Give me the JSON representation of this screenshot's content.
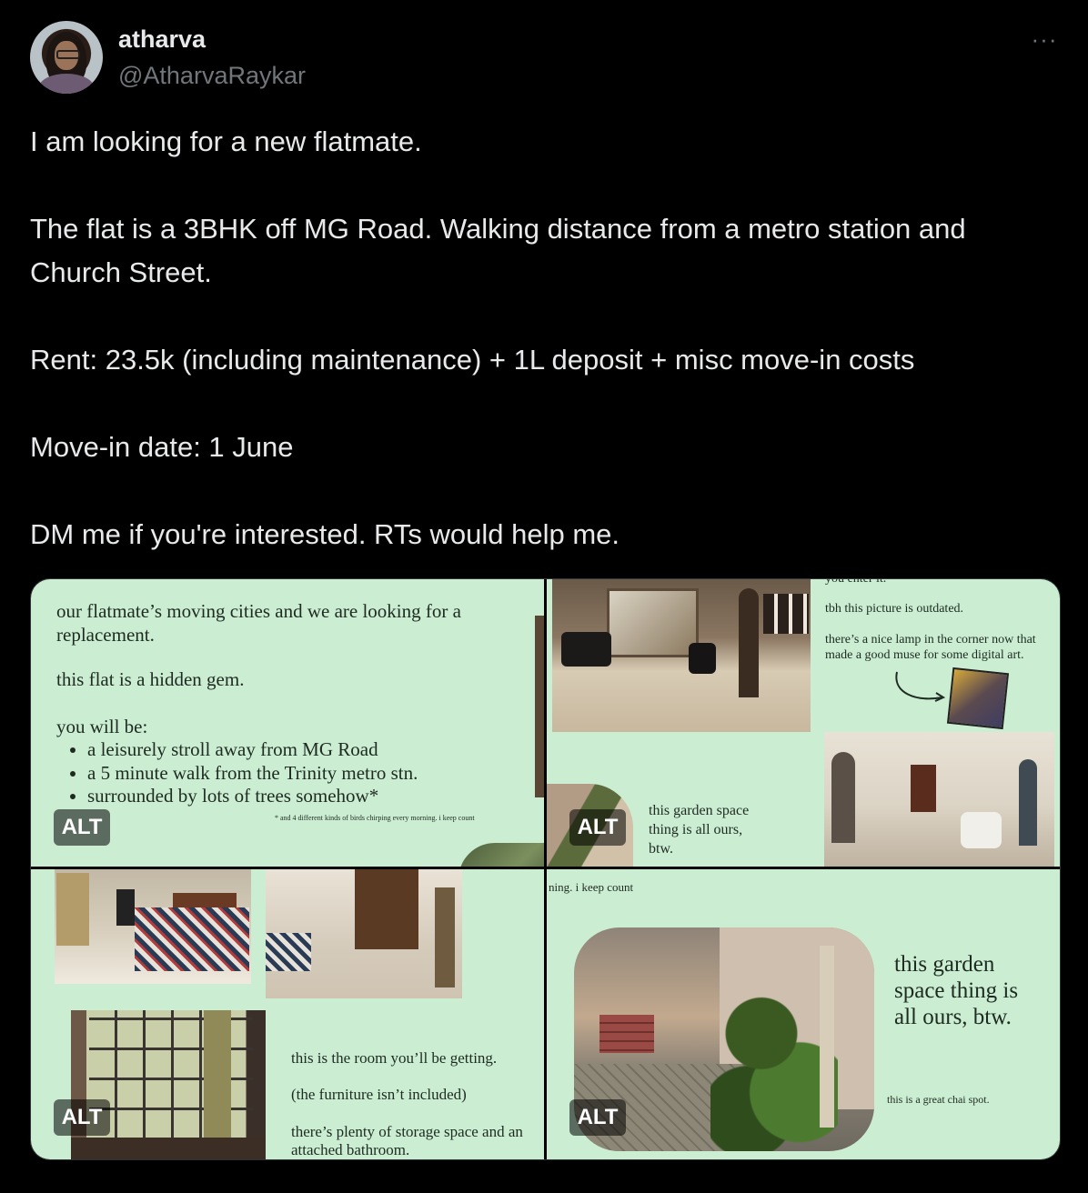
{
  "author": {
    "name": "atharva",
    "handle": "@AtharvaRaykar"
  },
  "more_label": "···",
  "tweet": {
    "p1": "I am looking for a new flatmate.",
    "p2": "The flat is a 3BHK off MG Road. Walking distance from a metro station and Church Street.",
    "p3": "Rent: 23.5k (including maintenance) + 1L deposit + misc move-in costs",
    "p4": "Move-in date: 1 June",
    "p5": "DM me if you're interested. RTs would help me."
  },
  "media": {
    "alt_badge": "ALT",
    "img1": {
      "lead": "our flatmate’s moving cities and we are looking for a replacement.",
      "line2": "this flat is a hidden gem.",
      "line3": "you will be:",
      "bullets": [
        "a leisurely stroll away from MG Road",
        "a 5 minute walk from the Trinity metro stn.",
        "surrounded by lots of trees somehow*"
      ],
      "footnote": "* and 4 different kinds of birds chirping every morning. i keep count"
    },
    "img2": {
      "top_cut": "you enter it.",
      "note1": "tbh this picture is outdated.",
      "note2": "there’s a nice lamp in the corner now that made a good muse for some digital art.",
      "garden_caption": "this garden space thing is all ours, btw."
    },
    "img3": {
      "line1": "this is the room you’ll be getting.",
      "line2": "(the furniture isn’t included)",
      "line3": "there’s plenty of storage space and an attached bathroom."
    },
    "img4": {
      "top_cut": "ning. i keep count",
      "caption": "this garden space thing is all ours, btw.",
      "small": "this is a great chai spot."
    }
  }
}
